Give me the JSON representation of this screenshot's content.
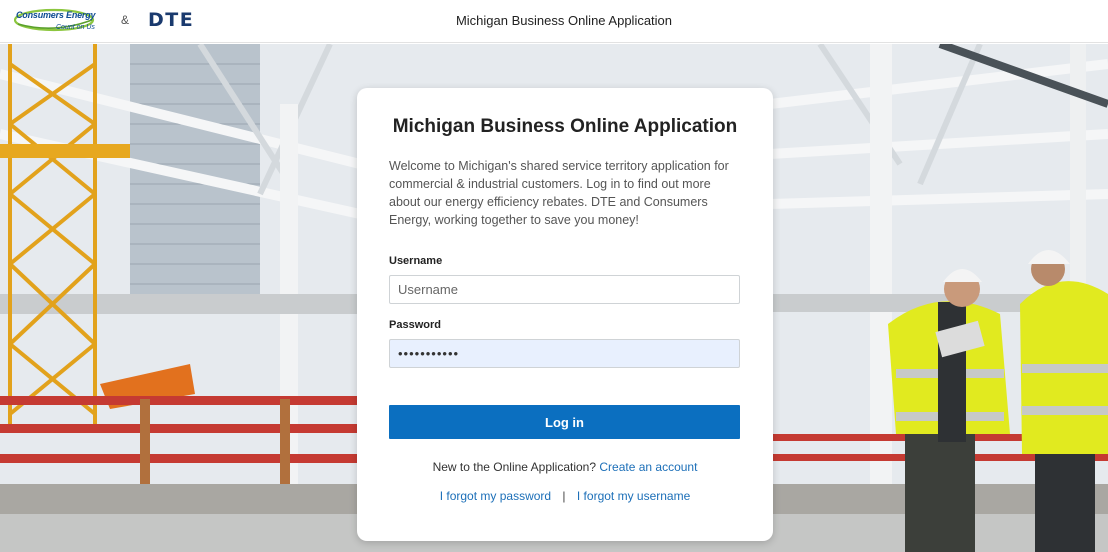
{
  "header": {
    "logo_left_text": "Consumers Energy",
    "logo_left_tagline": "Count on Us",
    "ampersand": "&",
    "logo_right_text": "DTE",
    "title": "Michigan Business Online Application"
  },
  "login": {
    "title": "Michigan Business Online Application",
    "description": "Welcome to Michigan's shared service territory application for commercial & industrial customers. Log in to find out more about our energy efficiency rebates. DTE and Consumers Energy, working together to save you money!",
    "username_label": "Username",
    "username_placeholder": "Username",
    "username_value": "",
    "password_label": "Password",
    "password_value": "•••••••••••",
    "login_button": "Log in",
    "new_prompt": "New to the Online Application?",
    "create_account_link": "Create an account",
    "forgot_password_link": "I forgot my password",
    "separator": "|",
    "forgot_username_link": "I forgot my username"
  },
  "colors": {
    "primary_button": "#0b6fc0",
    "link": "#1c6fb8",
    "brand_dte": "#1a3a6e",
    "brand_ce": "#0e4c92"
  },
  "icons": [
    "consumers-energy-logo",
    "dte-logo"
  ]
}
